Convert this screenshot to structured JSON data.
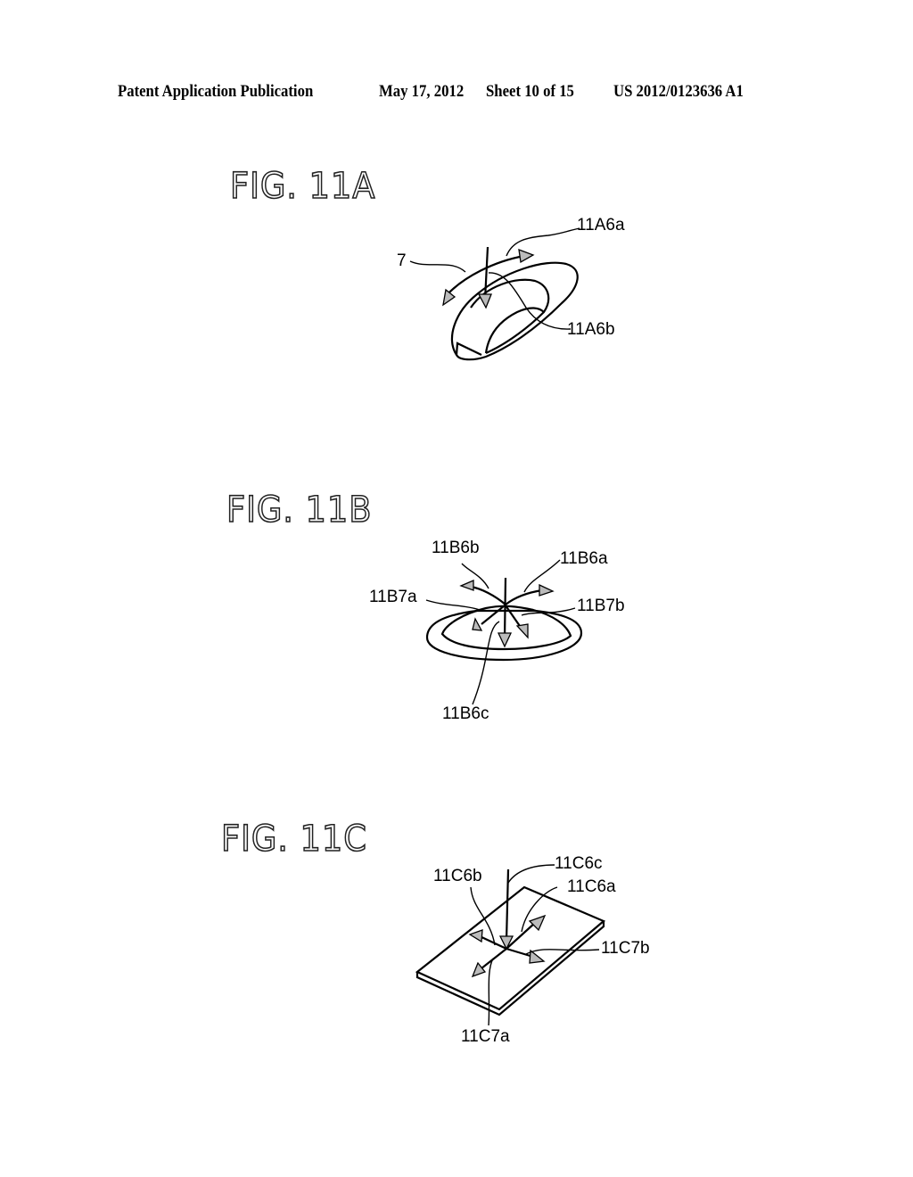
{
  "header": {
    "publication": "Patent Application Publication",
    "date": "May 17, 2012",
    "sheet": "Sheet 10 of 15",
    "number": "US 2012/0123636 A1"
  },
  "figures": [
    {
      "title": "FIG. 11A",
      "labels": {
        "l_11A6a": "11A6a",
        "l_7": "7",
        "l_11A6b": "11A6b"
      }
    },
    {
      "title": "FIG. 11B",
      "labels": {
        "l_11B6b": "11B6b",
        "l_11B6a": "11B6a",
        "l_11B7a": "11B7a",
        "l_11B7b": "11B7b",
        "l_11B6c": "11B6c"
      }
    },
    {
      "title": "FIG. 11C",
      "labels": {
        "l_11C6c": "11C6c",
        "l_11C6b": "11C6b",
        "l_11C6a": "11C6a",
        "l_11C7b": "11C7b",
        "l_11C7a": "11C7a"
      }
    }
  ]
}
